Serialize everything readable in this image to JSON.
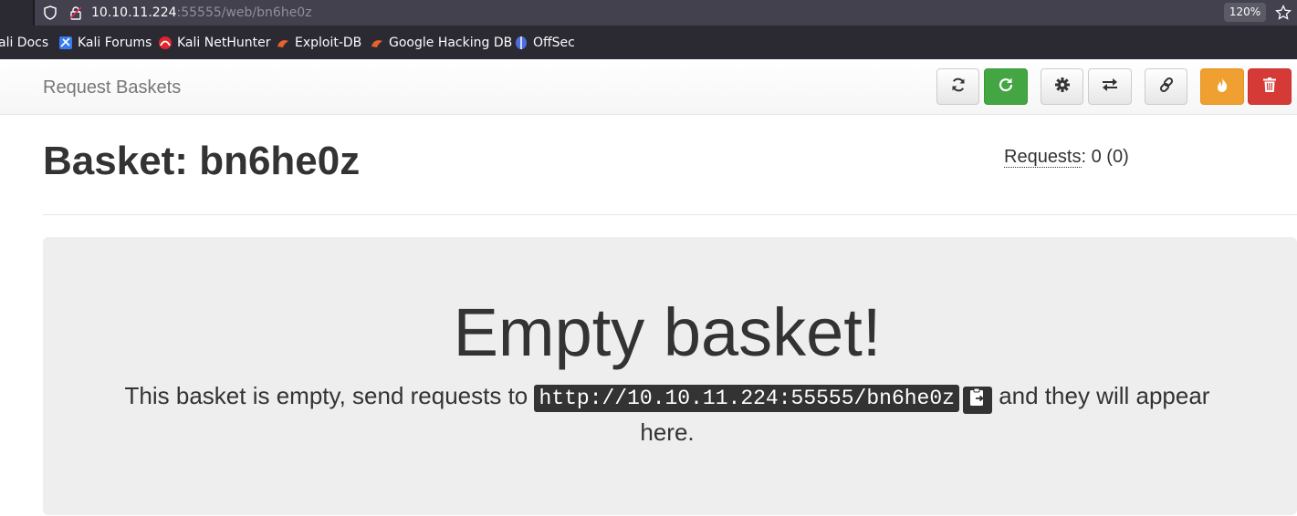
{
  "browser": {
    "url_host": "10.10.11.224",
    "url_path": ":55555/web/bn6he0z",
    "zoom": "120%",
    "bookmarks": [
      {
        "label": "ali Docs",
        "icon": "kali-docs-icon"
      },
      {
        "label": "Kali Forums",
        "icon": "kali-forums-icon"
      },
      {
        "label": "Kali NetHunter",
        "icon": "kali-nethunter-icon"
      },
      {
        "label": "Exploit-DB",
        "icon": "exploit-db-icon"
      },
      {
        "label": "Google Hacking DB",
        "icon": "ghdb-icon"
      },
      {
        "label": "OffSec",
        "icon": "offsec-icon"
      }
    ]
  },
  "navbar": {
    "brand": "Request Baskets",
    "buttons": [
      {
        "name": "refresh-button",
        "icon": "refresh-icon"
      },
      {
        "name": "auto-refresh-button",
        "icon": "auto-refresh-icon"
      },
      {
        "name": "settings-button",
        "icon": "gear-icon"
      },
      {
        "name": "responses-button",
        "icon": "exchange-icon"
      },
      {
        "name": "share-link-button",
        "icon": "link-icon"
      },
      {
        "name": "flush-button",
        "icon": "fire-icon"
      },
      {
        "name": "delete-button",
        "icon": "trash-icon"
      }
    ],
    "colors": {
      "success": "#43a643",
      "warning": "#f0a030",
      "danger": "#d63a36"
    }
  },
  "basket": {
    "title_prefix": "Basket: ",
    "name": "bn6he0z",
    "requests_label": "Requests",
    "requests_count": ": 0 (0)"
  },
  "empty": {
    "title": "Empty basket!",
    "text_before": "This basket is empty, send requests to ",
    "url": "http://10.10.11.224:55555/bn6he0z",
    "text_after": " and they will appear here."
  }
}
